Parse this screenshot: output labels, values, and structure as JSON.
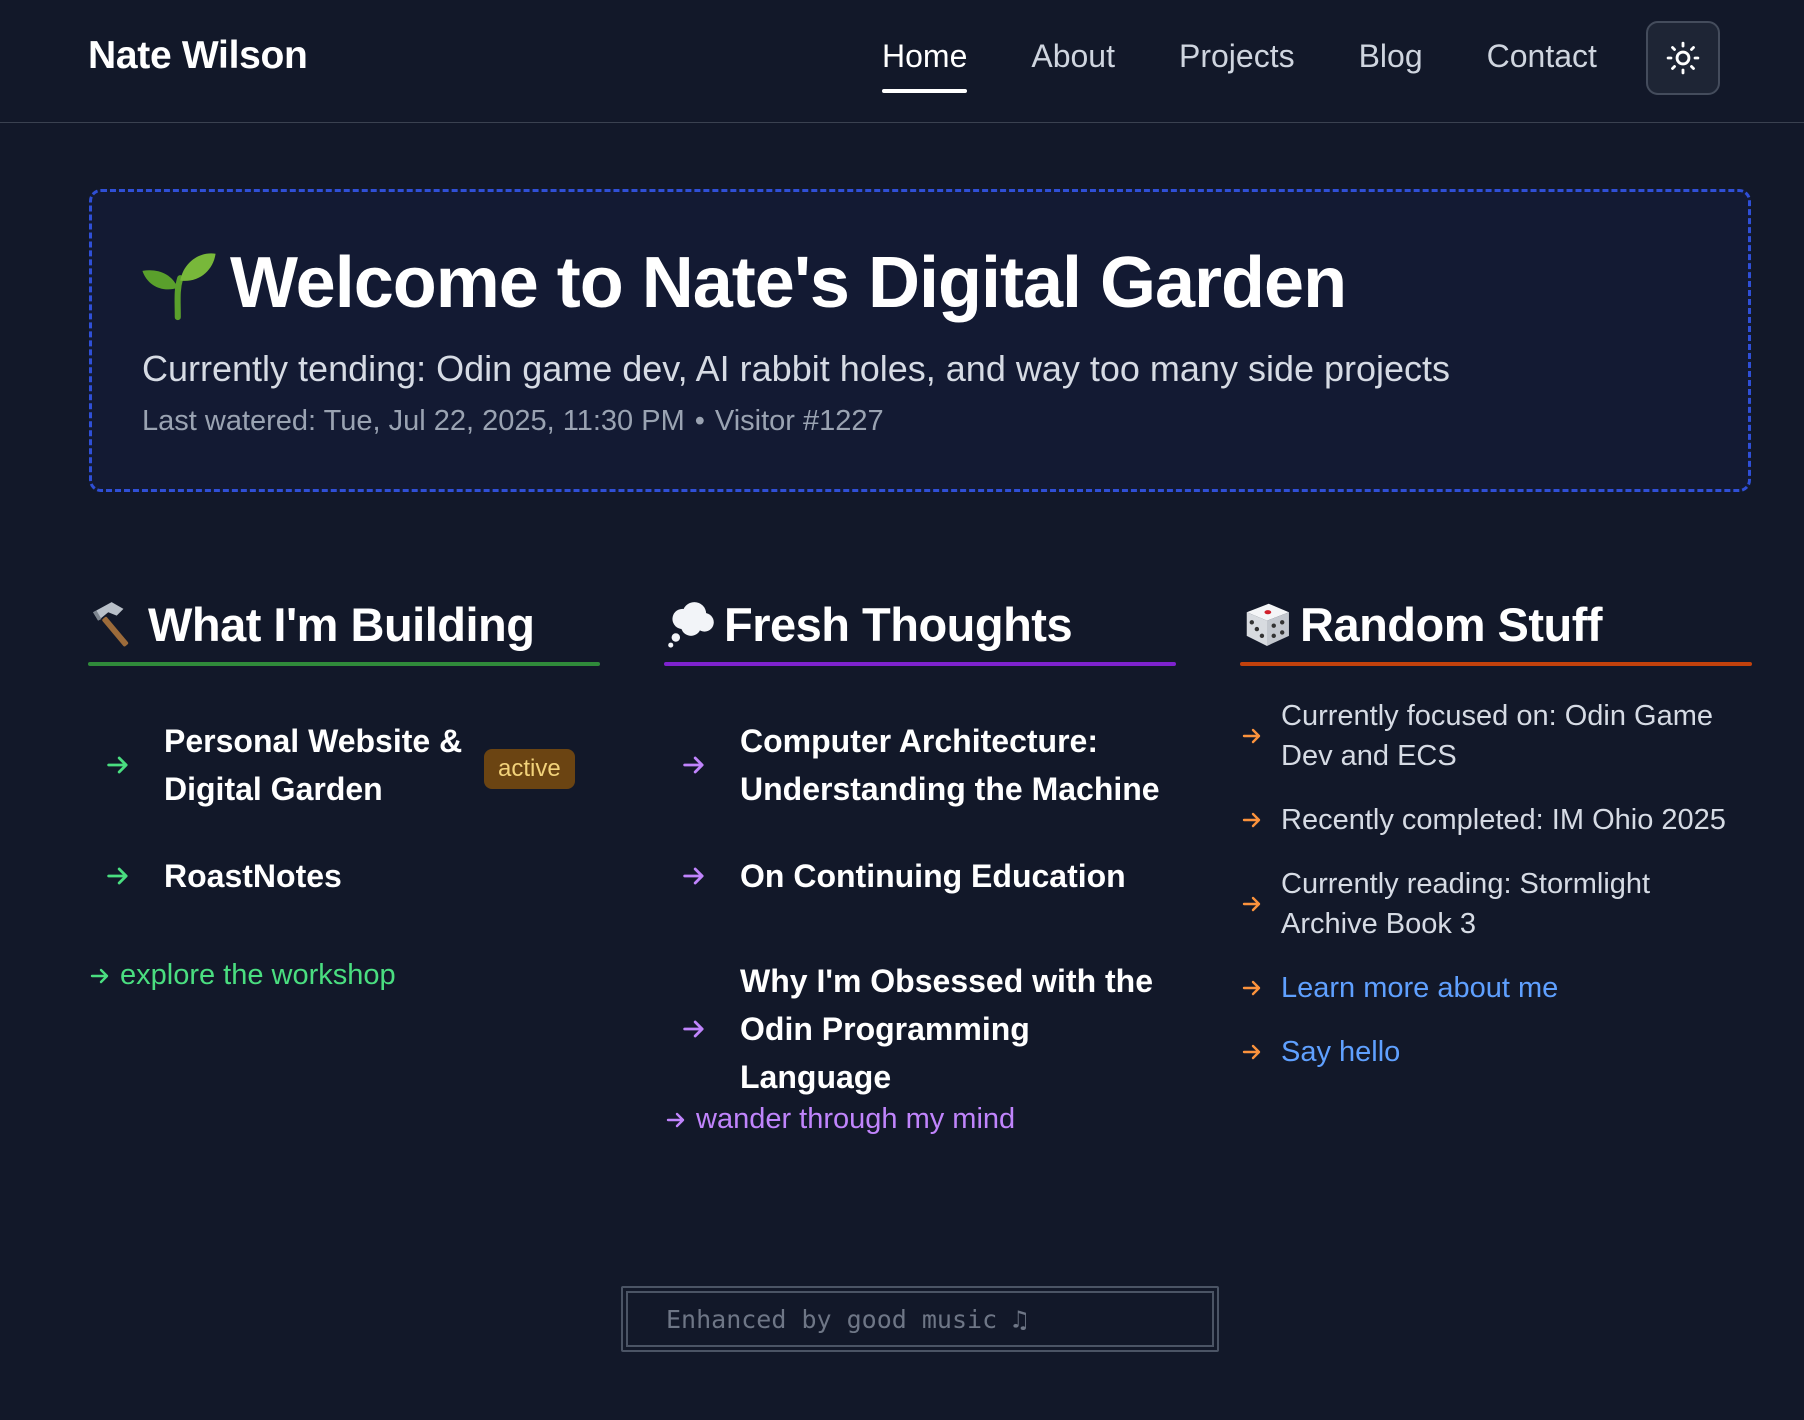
{
  "header": {
    "brand": "Nate Wilson",
    "nav": [
      {
        "label": "Home",
        "active": true
      },
      {
        "label": "About",
        "active": false
      },
      {
        "label": "Projects",
        "active": false
      },
      {
        "label": "Blog",
        "active": false
      },
      {
        "label": "Contact",
        "active": false
      }
    ],
    "theme_toggle_icon": "sun-icon"
  },
  "hero": {
    "icon": "seedling-icon",
    "title": "Welcome to Nate's Digital Garden",
    "subtitle": "Currently tending: Odin game dev, AI rabbit holes, and way too many side projects",
    "last_watered": "Last watered: Tue, Jul 22, 2025, 11:30 PM",
    "separator": "•",
    "visitor": "Visitor #1227",
    "border_color": "#2f4fd6"
  },
  "building": {
    "icon": "hammer-icon",
    "heading": "What I'm Building",
    "accent": "#2f8a3a",
    "items": [
      {
        "text_line1": "Personal Website &",
        "text_line2": "Digital Garden",
        "badge": "active"
      },
      {
        "text_line1": "RoastNotes"
      }
    ],
    "link": "explore the workshop",
    "link_color": "#4ade80"
  },
  "thoughts": {
    "icon": "thought-bubble-icon",
    "heading": "Fresh Thoughts",
    "accent": "#7e22ce",
    "items": [
      {
        "text_line1": "Computer Architecture:",
        "text_line2": "Understanding the Machine"
      },
      {
        "text_line1": "On Continuing Education"
      },
      {
        "text_line1": "Why I'm Obsessed with the",
        "text_line2": "Odin Programming Language"
      }
    ],
    "link": "wander through my mind",
    "link_color": "#c084fc"
  },
  "random": {
    "icon": "dice-icon",
    "heading": "Random Stuff",
    "accent": "#c2410c",
    "items": [
      {
        "text_line1": "Currently focused on: Odin Game",
        "text_line2": "Dev and ECS"
      },
      {
        "text_line1": "Recently completed: IM Ohio 2025"
      },
      {
        "text_line1": "Currently reading: Stormlight",
        "text_line2": "Archive Book 3"
      }
    ],
    "links": [
      "Learn more about me",
      "Say hello"
    ],
    "arrow_color": "#fb923c",
    "link_color": "#5fa0ff"
  },
  "footer": {
    "text": "Enhanced by good music ♫"
  }
}
